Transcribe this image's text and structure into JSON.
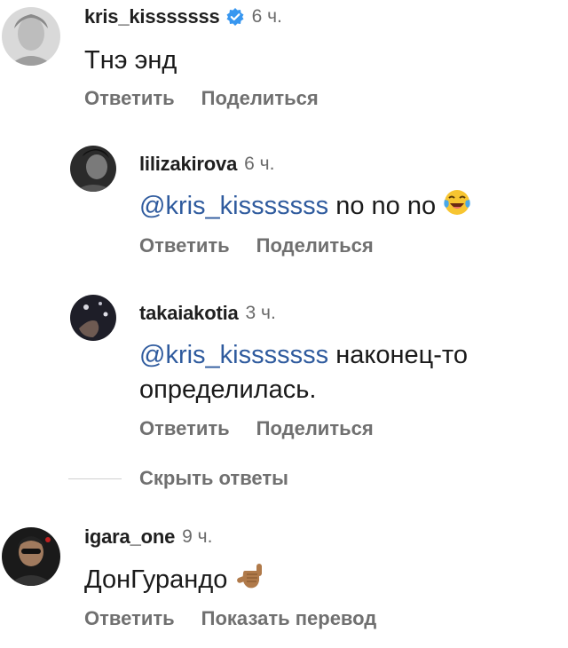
{
  "comments": [
    {
      "username": "kris_kisssssss",
      "verified": true,
      "time": "6 ч.",
      "text": "Тнэ энд",
      "actions": [
        "Ответить",
        "Поделиться"
      ]
    },
    {
      "username": "lilizakirova",
      "time": "6 ч.",
      "mention": "@kris_kisssssss",
      "text": "no no no",
      "emoji": "face-with-tears-of-joy",
      "actions": [
        "Ответить",
        "Поделиться"
      ]
    },
    {
      "username": "takaiakotia",
      "time": "3 ч.",
      "mention": "@kris_kisssssss",
      "text_line1": "наконец-то",
      "text_line2": "определилась.",
      "actions": [
        "Ответить",
        "Поделиться"
      ]
    },
    {
      "username": "igara_one",
      "time": "9 ч.",
      "text": "ДонГурандо",
      "emoji": "call-me-hand",
      "actions": [
        "Ответить",
        "Показать перевод"
      ]
    }
  ],
  "hide_replies_label": "Скрыть ответы",
  "colors": {
    "mention": "#2f5b9e",
    "verified": "#3897f0",
    "secondary_text": "#707070"
  }
}
